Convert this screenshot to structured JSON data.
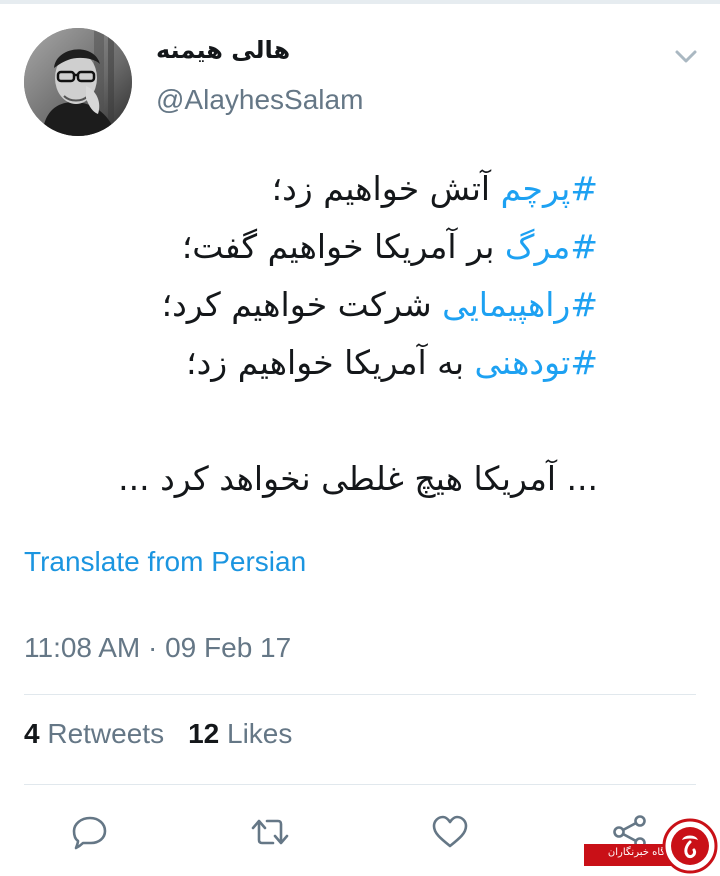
{
  "tweet": {
    "author": {
      "display_name": "هالی هیمنه",
      "handle": "@AlayhesSalam"
    },
    "lines": [
      {
        "hashtag": "#پرچم",
        "text": " آتش خواهیم زد؛"
      },
      {
        "hashtag": "#مرگ",
        "text": " بر آمریکا خواهیم گفت؛"
      },
      {
        "hashtag": "#راهپیمایی",
        "text": " شرکت خواهیم کرد؛"
      },
      {
        "hashtag": "#تودهنی",
        "text": " به آمریکا خواهیم زد؛"
      }
    ],
    "closing_line": "... آمریکا هیچ غلطی نخواهد کرد ...",
    "translate_label": "Translate from Persian",
    "timestamp": "11:08 AM · 09 Feb 17",
    "stats": {
      "retweets_count": "4",
      "retweets_label": "Retweets",
      "likes_count": "12",
      "likes_label": "Likes"
    }
  },
  "actions": [
    {
      "name": "reply",
      "icon": "reply-icon"
    },
    {
      "name": "retweet",
      "icon": "retweet-icon"
    },
    {
      "name": "like",
      "icon": "heart-icon"
    },
    {
      "name": "share",
      "icon": "share-icon"
    }
  ],
  "watermark": {
    "text": "باشگاه خبرنگاران"
  },
  "colors": {
    "link_blue": "#1da1f2",
    "secondary_text": "#657786",
    "primary_text": "#14171a",
    "divider": "#e1e8ed",
    "watermark_red": "#c91017"
  }
}
